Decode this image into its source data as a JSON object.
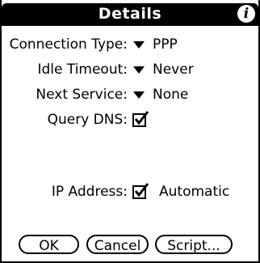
{
  "window": {
    "title": "Details",
    "info_icon": "info-icon"
  },
  "fields": {
    "connection_type": {
      "label": "Connection Type:",
      "value": "PPP"
    },
    "idle_timeout": {
      "label": "Idle Timeout:",
      "value": "Never"
    },
    "next_service": {
      "label": "Next Service:",
      "value": "None"
    },
    "query_dns": {
      "label": "Query DNS:",
      "checked": true
    },
    "ip_address": {
      "label": "IP Address:",
      "checked": true,
      "value": "Automatic"
    }
  },
  "buttons": {
    "ok": "OK",
    "cancel": "Cancel",
    "script": "Script..."
  }
}
